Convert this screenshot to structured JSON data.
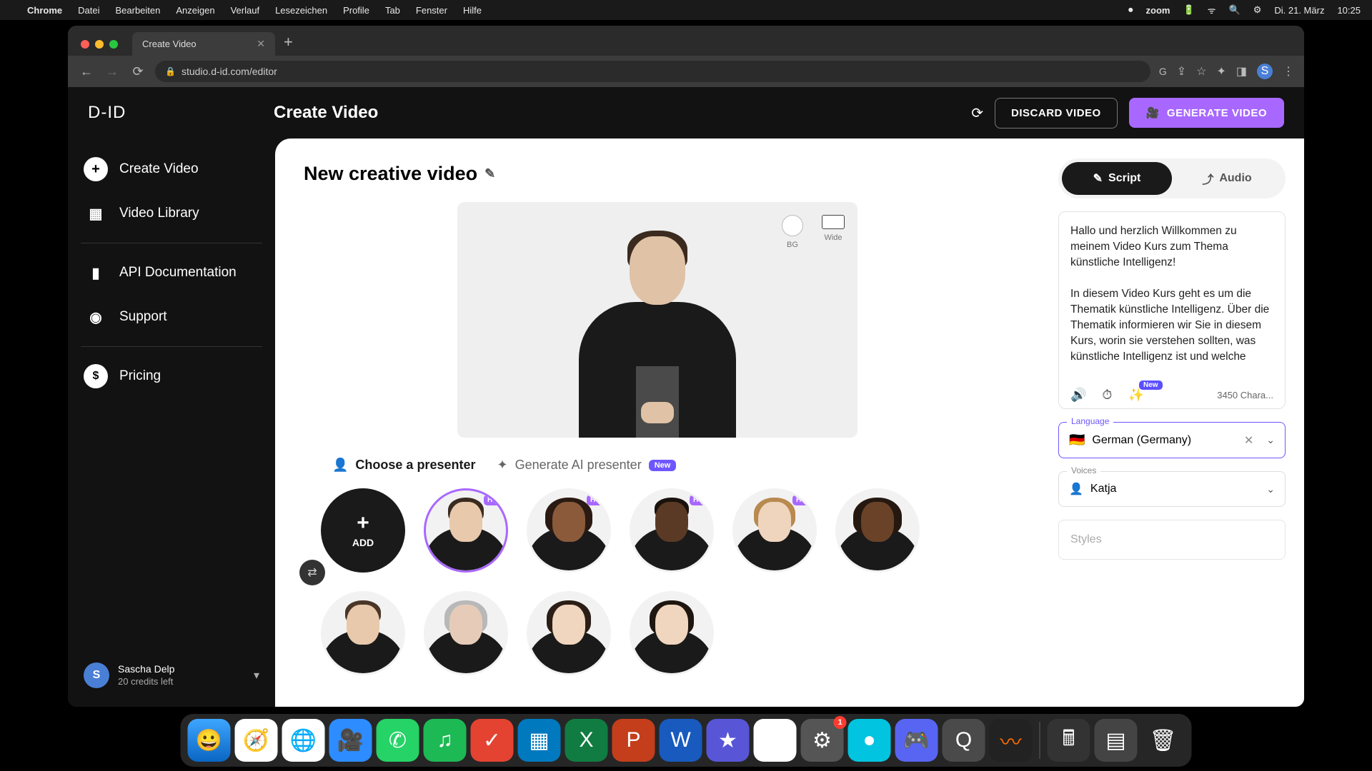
{
  "menubar": {
    "app": "Chrome",
    "items": [
      "Datei",
      "Bearbeiten",
      "Anzeigen",
      "Verlauf",
      "Lesezeichen",
      "Profile",
      "Tab",
      "Fenster",
      "Hilfe"
    ],
    "right": {
      "zoom": "zoom",
      "date": "Di. 21. März",
      "time": "10:25"
    }
  },
  "browser": {
    "tab_title": "Create Video",
    "url": "studio.d-id.com/editor",
    "profile_initial": "S"
  },
  "header": {
    "logo": "D-ID",
    "title": "Create Video",
    "discard": "DISCARD VIDEO",
    "generate": "GENERATE VIDEO"
  },
  "sidebar": {
    "items": [
      {
        "label": "Create Video"
      },
      {
        "label": "Video Library"
      },
      {
        "label": "API Documentation"
      },
      {
        "label": "Support"
      },
      {
        "label": "Pricing"
      }
    ],
    "user": {
      "initial": "S",
      "name": "Sascha Delp",
      "credits": "20 credits left"
    }
  },
  "canvas": {
    "video_title": "New creative video",
    "bg_label": "BG",
    "wide_label": "Wide",
    "tab_choose": "Choose a presenter",
    "tab_generate": "Generate AI presenter",
    "tab_generate_badge": "New",
    "add_label": "ADD",
    "hq": "HQ"
  },
  "panel": {
    "script_tab": "Script",
    "audio_tab": "Audio",
    "script_text": "Hallo und herzlich Willkommen zu meinem Video Kurs zum Thema künstliche Intelligenz!\n\nIn diesem Video Kurs geht es um die Thematik künstliche Intelligenz. Über die Thematik informieren wir Sie in diesem Kurs, worin sie verstehen sollten, was künstliche Intelligenz ist und welche",
    "tool_badge": "New",
    "char_count": "3450 Chara...",
    "language_label": "Language",
    "language_value": "German (Germany)",
    "voices_label": "Voices",
    "voices_value": "Katja",
    "styles_label": "Styles"
  },
  "dock": {
    "settings_badge": "1"
  },
  "presenters": [
    {
      "skin": "#e8c9ab",
      "hair": "#3a2b20",
      "hairW": 50,
      "hairH": 36
    },
    {
      "skin": "#8a5a3a",
      "hair": "#2a1a12",
      "hairW": 66,
      "hairH": 52
    },
    {
      "skin": "#5a3a24",
      "hair": "#1a120c",
      "hairW": 48,
      "hairH": 30
    },
    {
      "skin": "#efd5be",
      "hair": "#b88a4f",
      "hairW": 58,
      "hairH": 46
    },
    {
      "skin": "#6a4228",
      "hair": "#241810",
      "hairW": 68,
      "hairH": 54
    },
    {
      "skin": "#e8c9ab",
      "hair": "#4a3628",
      "hairW": 50,
      "hairH": 34
    },
    {
      "skin": "#e6ccb8",
      "hair": "#b8b8b8",
      "hairW": 60,
      "hairH": 48
    },
    {
      "skin": "#f0d6be",
      "hair": "#2a1e16",
      "hairW": 62,
      "hairH": 50
    },
    {
      "skin": "#f0d6be",
      "hair": "#1f160f",
      "hairW": 62,
      "hairH": 50
    }
  ]
}
